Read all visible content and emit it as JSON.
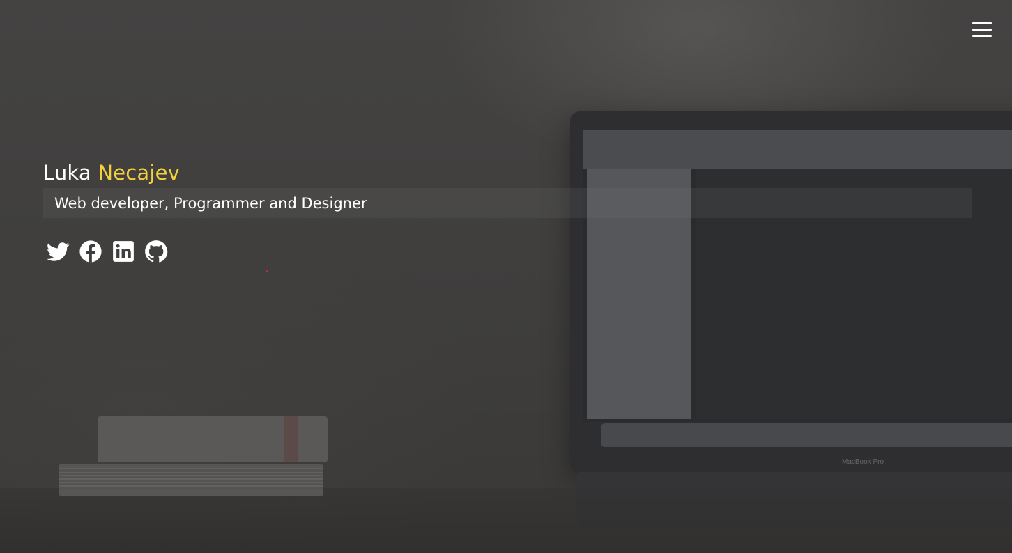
{
  "header": {
    "menu_icon": "hamburger-menu-icon"
  },
  "hero": {
    "first_name": "Luka",
    "last_name": "Necajev",
    "tagline": "Web developer, Programmer and Designer",
    "accent_color": "#f2d13d"
  },
  "social_links": [
    {
      "name": "twitter",
      "icon": "twitter-icon"
    },
    {
      "name": "facebook",
      "icon": "facebook-icon"
    },
    {
      "name": "linkedin",
      "icon": "linkedin-icon"
    },
    {
      "name": "github",
      "icon": "github-icon"
    }
  ],
  "background": {
    "laptop_label": "MacBook Pro"
  }
}
